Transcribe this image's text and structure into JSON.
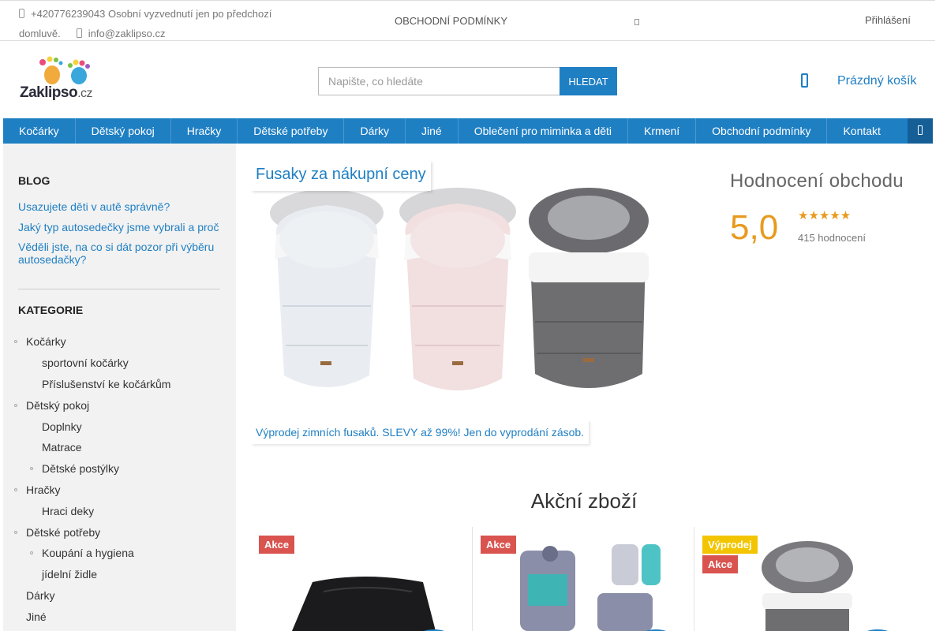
{
  "topbar": {
    "phone": "+420776239043 Osobní vyzvednutí jen po předchozí domluvě.",
    "email": "info@zaklipso.cz",
    "terms": "OBCHODNÍ PODMÍNKY",
    "login": "Přihlášení"
  },
  "header": {
    "logo_name": "Zaklipso",
    "logo_tld": ".cz",
    "search_placeholder": "Napište, co hledáte",
    "search_button": "HLEDAT",
    "cart": "Prázdný košík"
  },
  "nav": {
    "items": [
      "Kočárky",
      "Dětský pokoj",
      "Hračky",
      "Dětské potřeby",
      "Dárky",
      "Jiné",
      "Oblečení pro miminka a děti",
      "Krmení",
      "Obchodní podmínky",
      "Kontakt"
    ]
  },
  "sidebar": {
    "blog_title": "BLOG",
    "blog_links": [
      "Usazujete děti v autě správně?",
      "Jaký typ autosedečky jsme vybrali a proč",
      "Věděli jste, na co si dát pozor při výběru autosedačky?"
    ],
    "categories_title": "KATEGORIE",
    "categories": [
      "Kočárky",
      "sportovní kočárky",
      "Příslušenství ke kočárkům",
      "Dětský pokoj",
      "Doplnky",
      "Matrace",
      "Dětské postýlky",
      "Hračky",
      "Hraci deky",
      "Dětské potřeby",
      "Koupání a hygiena",
      "jídelní židle",
      "Dárky",
      "Jiné"
    ]
  },
  "banner": {
    "title": "Fusaky za nákupní ceny",
    "subtitle": "Výprodej zimních fusaků. SLEVY až 99%! Jen do vyprodání zásob."
  },
  "rating": {
    "title": "Hodnocení obchodu",
    "score": "5,0",
    "stars": "★★★★★",
    "count": "415 hodnocení"
  },
  "section": {
    "title": "Akční zboží"
  },
  "products": [
    {
      "badges": [
        "Akce"
      ]
    },
    {
      "badges": [
        "Akce"
      ]
    },
    {
      "badges": [
        "Výprodej",
        "Akce"
      ]
    }
  ],
  "colors": {
    "primary": "#1f7fc3",
    "sale_badge": "#d9534f",
    "clearance_badge": "#f2c500",
    "rating": "#e89a1f"
  }
}
